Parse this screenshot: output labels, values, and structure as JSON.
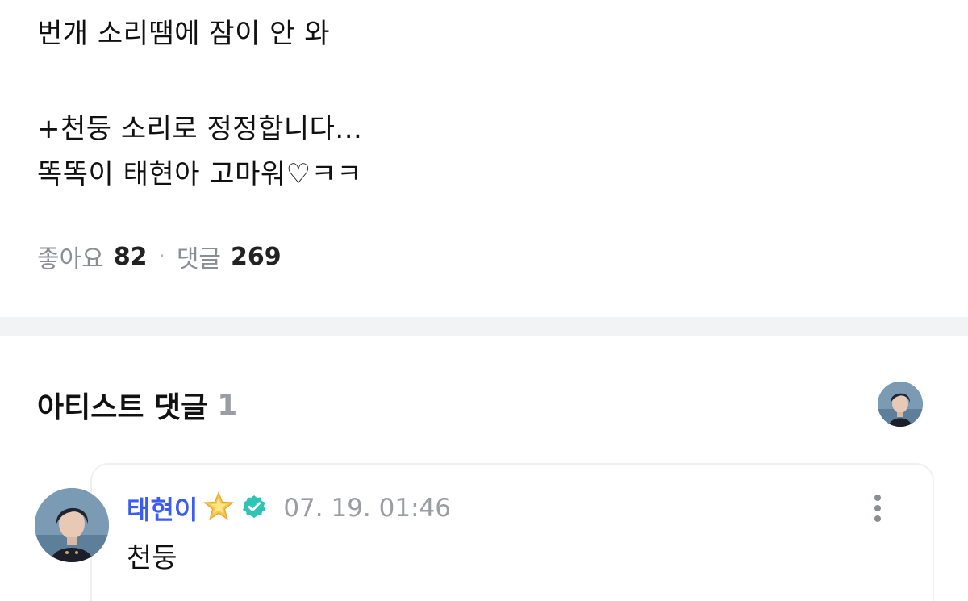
{
  "post": {
    "lines": [
      "번개 소리땜에 잠이 안 와",
      "+천둥 소리로 정정합니다...",
      "똑똑이 태현아 고마워♡ㅋㅋ"
    ],
    "likes_label": "좋아요",
    "likes_count": "82",
    "separator": "·",
    "comments_label": "댓글",
    "comments_count": "269"
  },
  "artist_comments": {
    "title": "아티스트 댓글",
    "count": "1",
    "items": [
      {
        "author": "태현이",
        "author_badge_icon": "star-icon",
        "verified_icon": "verified-badge-icon",
        "timestamp": "07. 19. 01:46",
        "text": "천둥"
      }
    ]
  },
  "colors": {
    "author_name": "#3b5cf0",
    "verified_badge": "#2ec4b6",
    "star": "#f7c948",
    "muted_text": "#9a9da3",
    "divider": "#f2f3f5"
  }
}
